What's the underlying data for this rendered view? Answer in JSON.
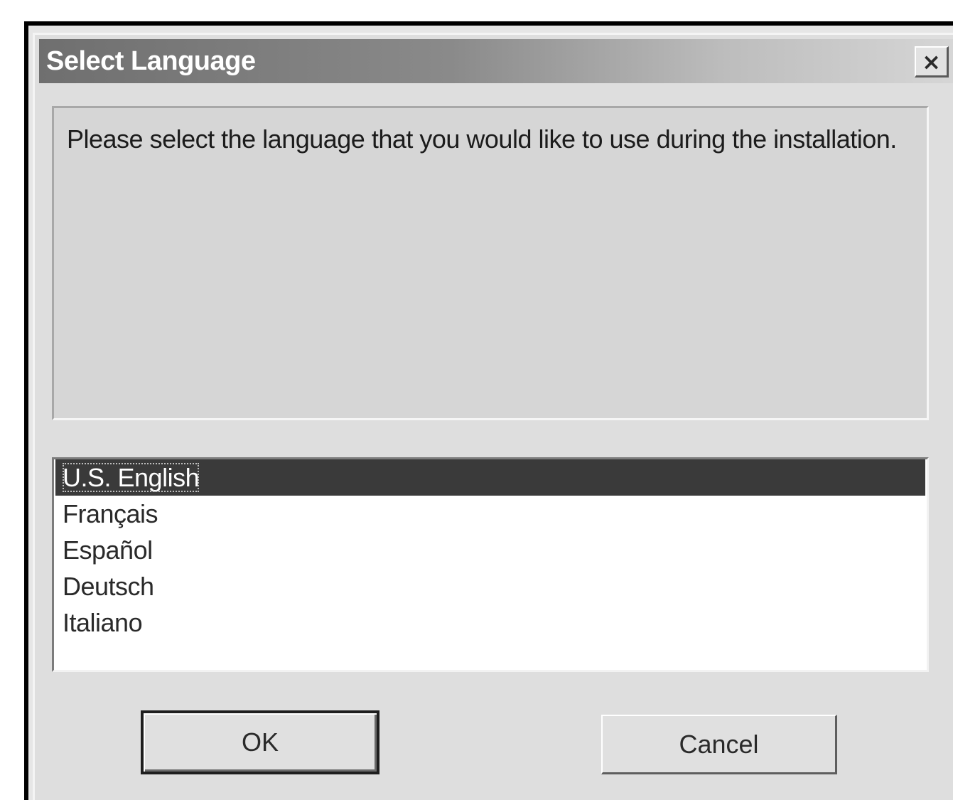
{
  "window": {
    "title": "Select Language",
    "close_label": "×"
  },
  "message": {
    "text": "Please select the language that you would like to use during the installation."
  },
  "languages": {
    "selected_index": 0,
    "items": [
      {
        "label": "U.S. English"
      },
      {
        "label": "Français"
      },
      {
        "label": "Español"
      },
      {
        "label": "Deutsch"
      },
      {
        "label": "Italiano"
      }
    ]
  },
  "buttons": {
    "ok_label": "OK",
    "cancel_label": "Cancel"
  },
  "colors": {
    "selection_background": "#3a3a3a",
    "title_bar_start": "#6f6f6f",
    "dialog_face": "#dedede"
  }
}
